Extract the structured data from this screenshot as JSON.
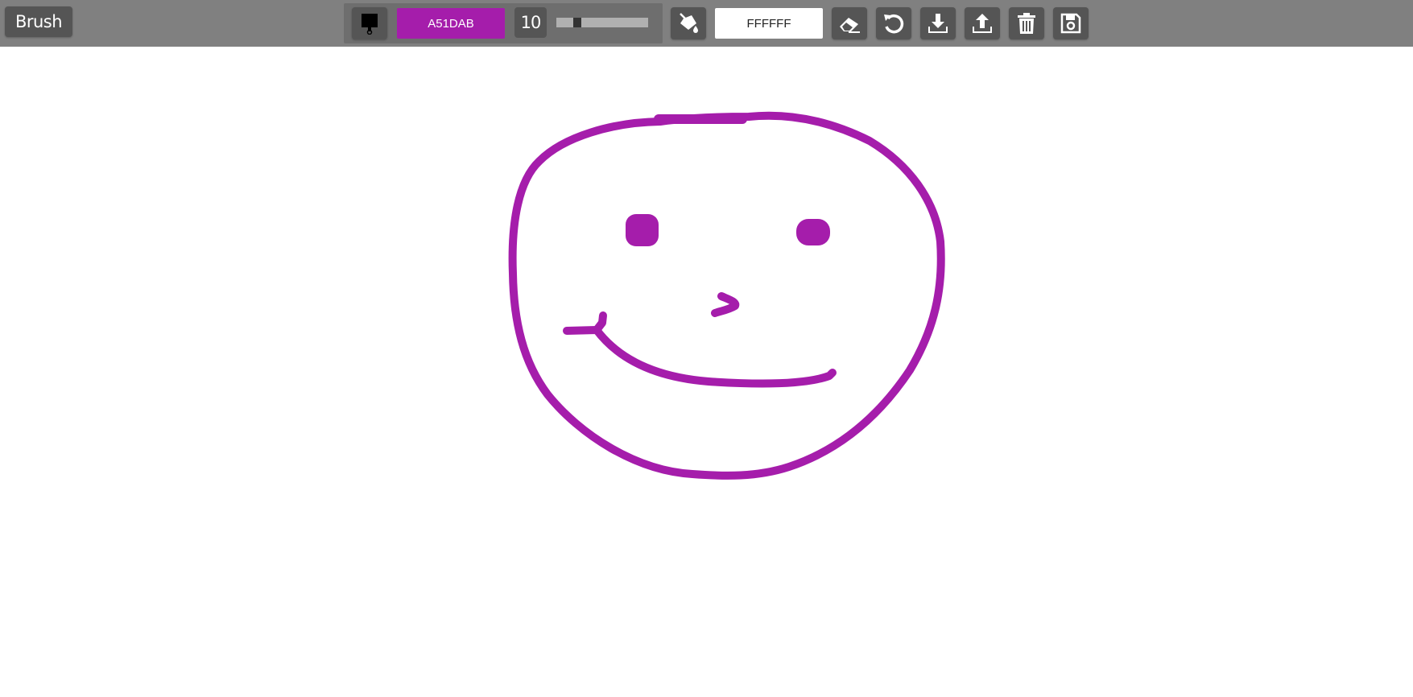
{
  "toolbar": {
    "mode_label": "Brush",
    "brush_color": "A51DAB",
    "brush_size": "10",
    "brush_size_slider_fraction": 0.2,
    "fill_color": "FFFFFF",
    "icons": {
      "brush": "paintbrush-icon",
      "fill": "paint-bucket-icon",
      "eraser": "eraser-icon",
      "undo": "undo-icon",
      "download": "download-icon",
      "upload": "upload-icon",
      "clear": "trash-icon",
      "save": "save-icon"
    }
  },
  "colors": {
    "toolbar_bg": "#808080",
    "button_bg": "#555555",
    "brush_swatch": "#A51DAB",
    "fill_swatch": "#FFFFFF",
    "stroke": "#A51DAB"
  },
  "canvas": {
    "drawing": "smiley-face"
  }
}
